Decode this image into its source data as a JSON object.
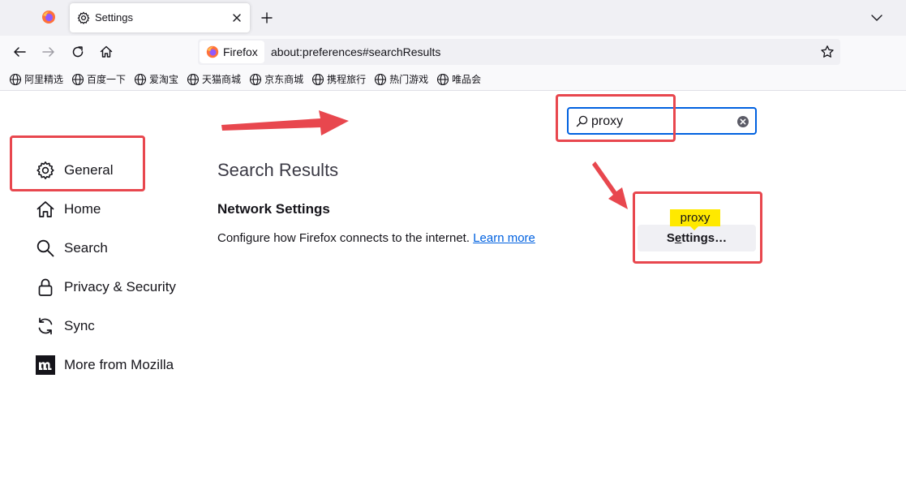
{
  "tabs": [
    {
      "title": "Settings"
    }
  ],
  "urlbar": {
    "identity_label": "Firefox",
    "url": "about:preferences#searchResults"
  },
  "bookmarks": [
    {
      "label": "阿里精选"
    },
    {
      "label": "百度一下"
    },
    {
      "label": "爱淘宝"
    },
    {
      "label": "天猫商城"
    },
    {
      "label": "京东商城"
    },
    {
      "label": "携程旅行"
    },
    {
      "label": "热门游戏"
    },
    {
      "label": "唯品会"
    }
  ],
  "sidebar": {
    "items": [
      {
        "label": "General",
        "icon": "gear-icon"
      },
      {
        "label": "Home",
        "icon": "home-icon"
      },
      {
        "label": "Search",
        "icon": "magnifier-icon"
      },
      {
        "label": "Privacy & Security",
        "icon": "lock-icon"
      },
      {
        "label": "Sync",
        "icon": "sync-icon"
      },
      {
        "label": "More from Mozilla",
        "icon": "mozilla-logo-icon"
      }
    ]
  },
  "search": {
    "value": "proxy"
  },
  "main": {
    "results_title": "Search Results",
    "section_title": "Network Settings",
    "description": "Configure how Firefox connects to the internet.",
    "learn_more": "Learn more",
    "settings_button_prefix": "S",
    "settings_button_accesskey": "e",
    "settings_button_suffix": "ttings…",
    "tooltip": "proxy"
  },
  "colors": {
    "accent": "#0061e0",
    "annotation": "#e8474e",
    "tooltip": "#ffe900"
  }
}
